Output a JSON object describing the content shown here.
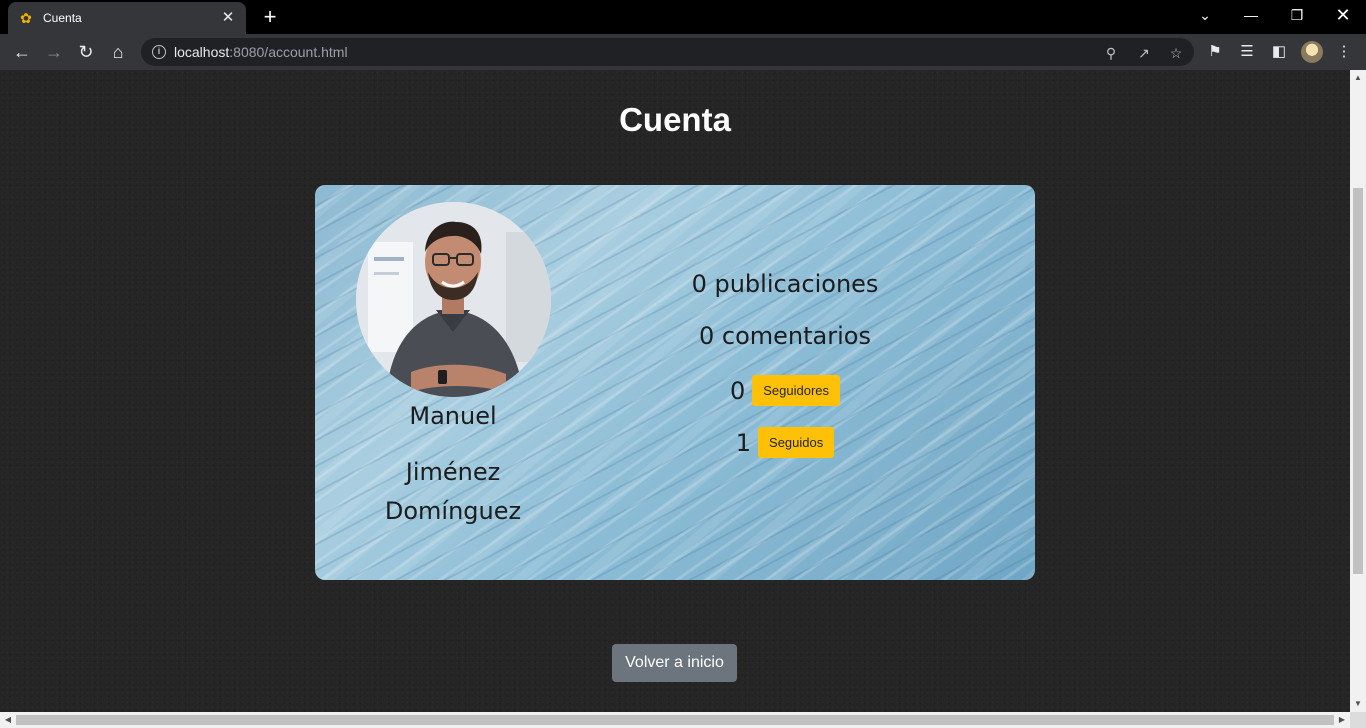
{
  "browser": {
    "tab_title": "Cuenta",
    "url_host": "localhost",
    "url_rest": ":8080/account.html"
  },
  "page": {
    "title": "Cuenta",
    "user": {
      "first_name": "Manuel",
      "last_name_1": "Jiménez",
      "last_name_2": "Domínguez"
    },
    "stats": {
      "publicaciones": "0 publicaciones",
      "comentarios": "0 comentarios",
      "seguidores_count": "0",
      "seguidores_label": "Seguidores",
      "seguidos_count": "1",
      "seguidos_label": "Seguidos"
    },
    "back_button": "Volver a inicio"
  },
  "colors": {
    "accent_pill": "#ffc107",
    "button_secondary": "#6c757d",
    "page_background": "#252525"
  }
}
